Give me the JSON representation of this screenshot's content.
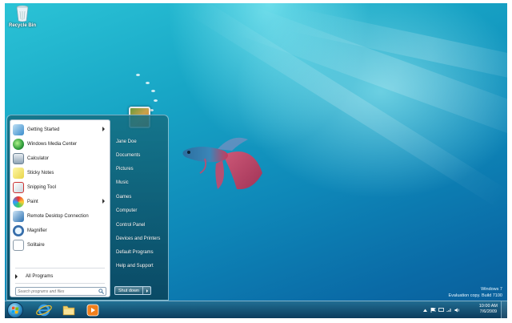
{
  "desktop": {
    "recycle_bin_label": "Recycle Bin"
  },
  "start_menu": {
    "user_name": "Jane Doe",
    "programs": [
      {
        "label": "Getting Started",
        "icon": "getting-started-icon",
        "has_submenu": true
      },
      {
        "label": "Windows Media Center",
        "icon": "media-center-icon",
        "has_submenu": false
      },
      {
        "label": "Calculator",
        "icon": "calculator-icon",
        "has_submenu": false
      },
      {
        "label": "Sticky Notes",
        "icon": "sticky-notes-icon",
        "has_submenu": false
      },
      {
        "label": "Snipping Tool",
        "icon": "scissors-icon",
        "has_submenu": false
      },
      {
        "label": "Paint",
        "icon": "paint-icon",
        "has_submenu": true
      },
      {
        "label": "Remote Desktop Connection",
        "icon": "remote-desktop-icon",
        "has_submenu": false
      },
      {
        "label": "Magnifier",
        "icon": "magnifier-icon",
        "has_submenu": false
      },
      {
        "label": "Solitaire",
        "icon": "solitaire-icon",
        "has_submenu": false
      }
    ],
    "all_programs_label": "All Programs",
    "search_placeholder": "Search programs and files",
    "right_items": [
      "Jane Doe",
      "Documents",
      "Pictures",
      "Music",
      "Games",
      "Computer",
      "Control Panel",
      "Devices and Printers",
      "Default Programs",
      "Help and Support"
    ],
    "shutdown_label": "Shut down"
  },
  "watermark": {
    "line1": "Windows 7",
    "line2": "Evaluation copy. Build 7100"
  },
  "taskbar": {
    "pinned": [
      "internet-explorer-icon",
      "windows-explorer-icon",
      "media-player-icon"
    ],
    "clock_time": "10:00 AM",
    "clock_date": "7/6/2009"
  },
  "colors": {
    "desktop_accent": "#18a6c6",
    "start_menu_bg": "#0f5a78",
    "taskbar_bg": "#12506f"
  }
}
